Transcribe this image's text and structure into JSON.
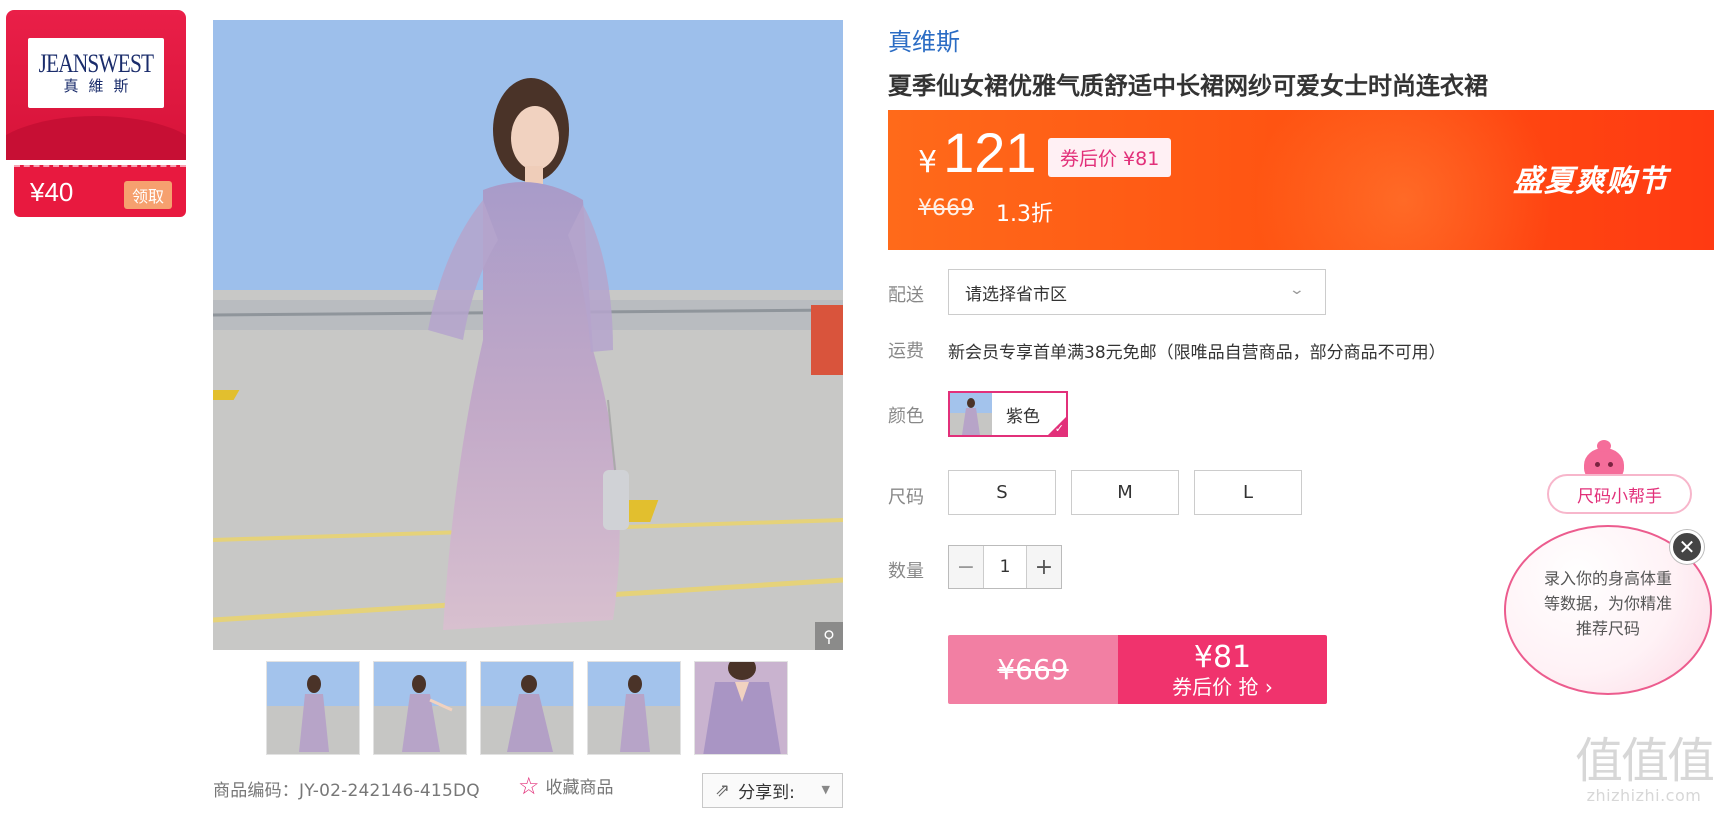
{
  "coupon": {
    "brand_logo_en": "JEANSWEST",
    "brand_logo_cn": "真維斯",
    "amount": "¥40",
    "claim_label": "领取"
  },
  "gallery": {
    "zoom_icon": "magnifier-icon",
    "thumbnail_count": 5
  },
  "product": {
    "brand": "真维斯",
    "title": "夏季仙女裙优雅气质舒适中长裙网纱可爱女士时尚连衣裙",
    "sku_label": "商品编码：JY-02-242146-415DQ",
    "favorite_label": "收藏商品",
    "share_label": "分享到:"
  },
  "price": {
    "currency": "¥",
    "current": "121",
    "after_coupon": "券后价 ¥81",
    "original": "¥669",
    "discount": "1.3折",
    "promo": "盛夏爽购节"
  },
  "delivery": {
    "label": "配送",
    "placeholder": "请选择省市区"
  },
  "shipping": {
    "label": "运费",
    "text": "新会员专享首单满38元免邮（限唯品自营商品，部分商品不可用）"
  },
  "color": {
    "label": "颜色",
    "selected": "紫色"
  },
  "size": {
    "label": "尺码",
    "options": [
      "S",
      "M",
      "L"
    ]
  },
  "quantity": {
    "label": "数量",
    "value": "1",
    "minus": "−",
    "plus": "+"
  },
  "buy": {
    "original": "¥669",
    "price": "¥81",
    "cta": "券后价 抢 ›"
  },
  "size_helper": {
    "title": "尺码小帮手",
    "message": "录入你的身高体重等数据，为你精准推荐尺码",
    "close": "✕"
  },
  "watermark": {
    "big": "值值值",
    "small": "zhizhizhi.com"
  },
  "colors": {
    "accent_pink": "#e2307a",
    "banner_orange": "#ff4e10",
    "brand_blue": "#2b6cc4"
  }
}
